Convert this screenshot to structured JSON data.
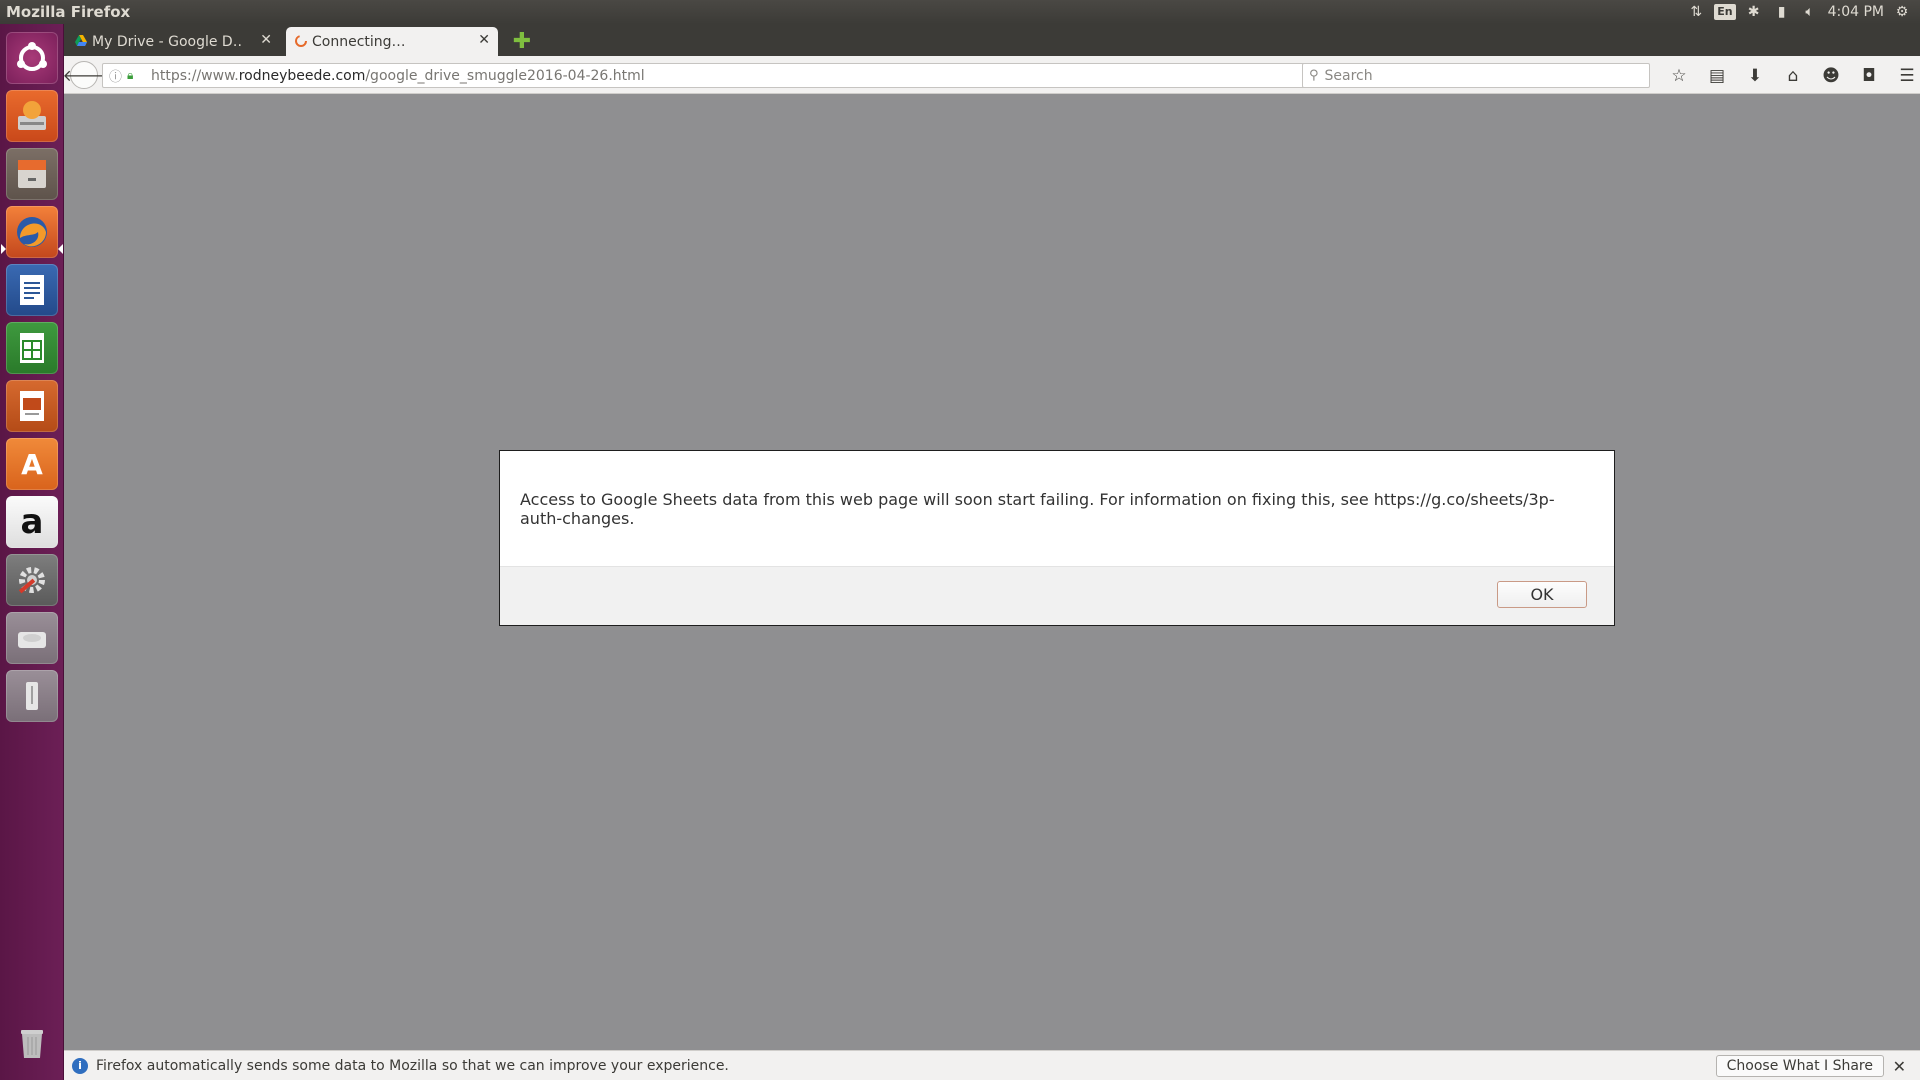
{
  "top_panel": {
    "window_title": "Mozilla Firefox",
    "keyboard_layout": "En",
    "clock": "4:04 PM"
  },
  "launcher": {
    "items": [
      {
        "name": "dash-home",
        "icon": "ubuntu-logo-icon"
      },
      {
        "name": "system-installer",
        "icon": "installer-icon"
      },
      {
        "name": "files",
        "icon": "file-cabinet-icon"
      },
      {
        "name": "firefox",
        "icon": "firefox-icon"
      },
      {
        "name": "libreoffice-writer",
        "icon": "writer-icon"
      },
      {
        "name": "libreoffice-calc",
        "icon": "calc-icon"
      },
      {
        "name": "libreoffice-impress",
        "icon": "impress-icon"
      },
      {
        "name": "software-center",
        "icon": "shopping-bag-icon"
      },
      {
        "name": "amazon",
        "icon": "amazon-icon"
      },
      {
        "name": "system-settings",
        "icon": "settings-icon"
      },
      {
        "name": "disk-drive",
        "icon": "hard-drive-icon"
      },
      {
        "name": "usb-drive",
        "icon": "usb-icon"
      },
      {
        "name": "trash",
        "icon": "trash-icon"
      }
    ],
    "amazon_letter": "a",
    "software_letter": "A"
  },
  "tabs": [
    {
      "label": "My Drive - Google D…",
      "active": false,
      "icon": "google-drive-icon"
    },
    {
      "label": "Connecting…",
      "active": true,
      "icon": "loading-spinner-icon"
    }
  ],
  "new_tab_symbol": "✚",
  "close_symbol": "✕",
  "navbar": {
    "url_prefix": "https://www.",
    "url_domain": "rodneybeede.com",
    "url_path": "/google_drive_smuggle2016-04-26.html",
    "search_placeholder": "Search"
  },
  "dialog": {
    "message": "Access to Google Sheets data from this web page will soon start failing.  For information on fixing this, see https://g.co/sheets/3p-auth-changes.",
    "ok_label": "OK"
  },
  "notification": {
    "text": "Firefox automatically sends some data to Mozilla so that we can improve your experience.",
    "button_label": "Choose What I Share"
  },
  "colors": {
    "launcher_bg": "#6c1f56",
    "panel_bg": "#3c3b37",
    "content_bg": "#8f8f91",
    "secure_lock": "#3a9d3a"
  }
}
